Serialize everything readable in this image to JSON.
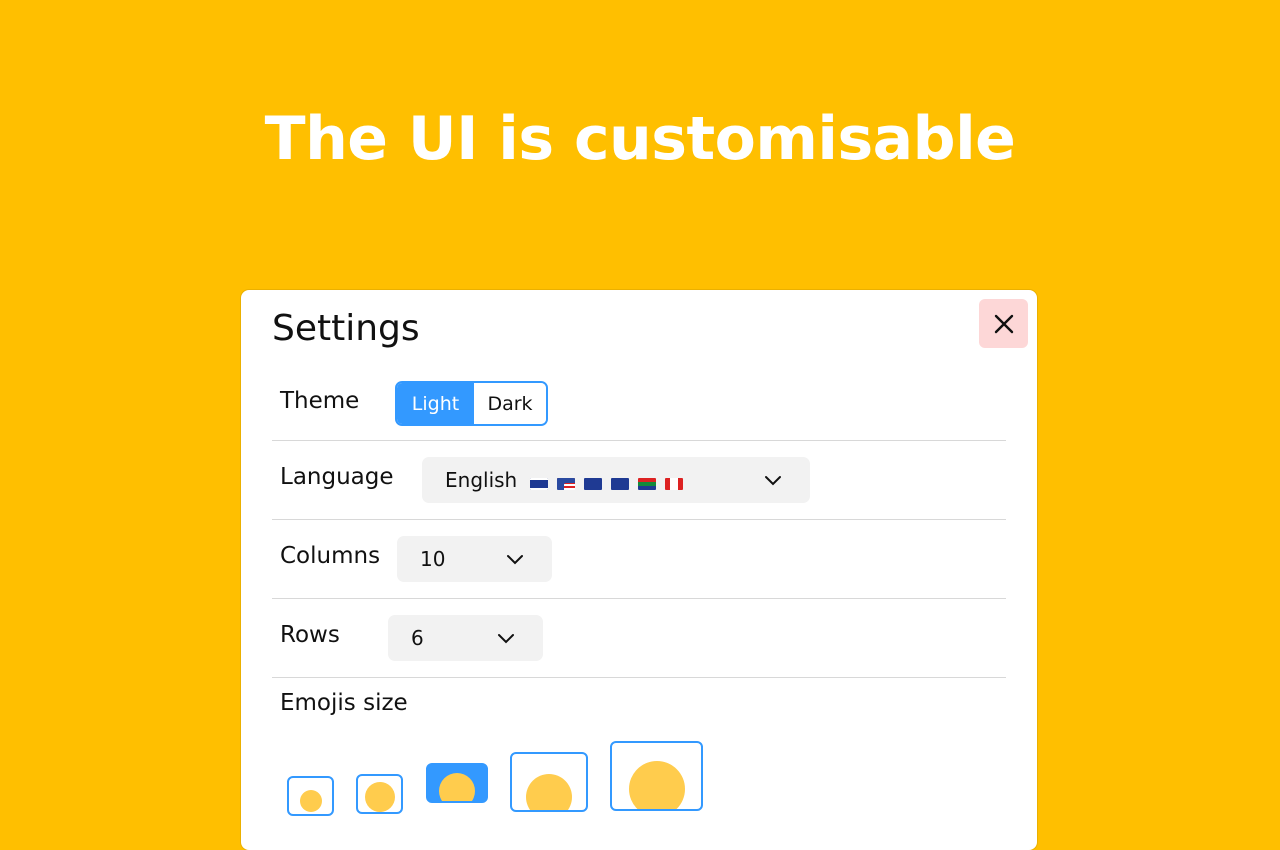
{
  "headline": "The UI is customisable",
  "settings": {
    "title": "Settings",
    "close_icon": "close-icon",
    "theme": {
      "label": "Theme",
      "options": [
        "Light",
        "Dark"
      ],
      "selected": "Light"
    },
    "language": {
      "label": "Language",
      "value": "English",
      "flags": [
        "flag-gb",
        "flag-us",
        "flag-au",
        "flag-nz",
        "flag-za",
        "flag-ca"
      ]
    },
    "columns": {
      "label": "Columns",
      "value": "10"
    },
    "rows": {
      "label": "Rows",
      "value": "6"
    },
    "emoji_size": {
      "label": "Emojis size",
      "options_count": 5,
      "selected_index": 2,
      "emoji": "face-with-tongue"
    }
  },
  "colors": {
    "background": "#ffbf00",
    "accent": "#3399ff",
    "close_bg": "#fdd7d7"
  }
}
